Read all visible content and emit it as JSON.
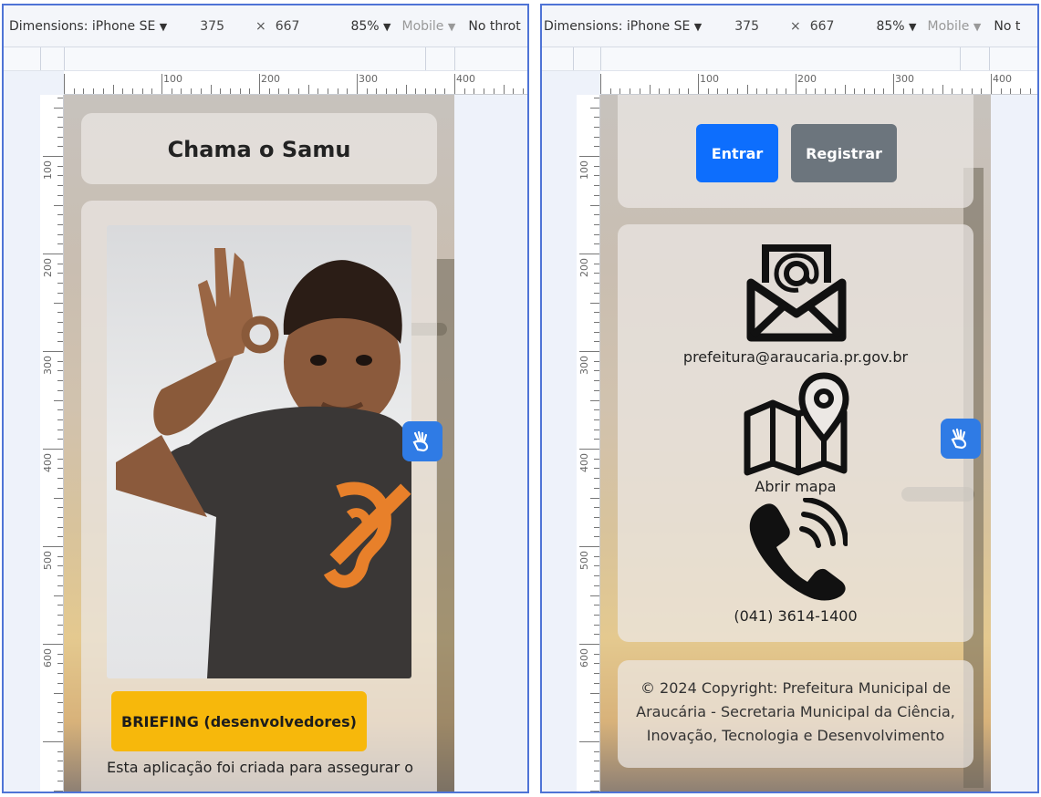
{
  "devtools": {
    "dimensions_label": "Dimensions: iPhone SE",
    "width": "375",
    "times": "×",
    "height": "667",
    "zoom": "85%",
    "mobile": "Mobile",
    "throttle_left": "No throt",
    "throttle_right": "No t",
    "caret": "▼"
  },
  "ruler": {
    "h_labels": [
      "100",
      "200",
      "300",
      "400"
    ],
    "v_labels": [
      "100",
      "200",
      "300",
      "400",
      "500",
      "600"
    ]
  },
  "left_page": {
    "title": "Chama o Samu",
    "briefing_button": "BRIEFING (desenvolvedores)",
    "description": "Esta aplicação foi criada para assegurar o"
  },
  "right_page": {
    "login_button": "Entrar",
    "register_button": "Registrar",
    "email": "prefeitura@araucaria.pr.gov.br",
    "map_link": "Abrir mapa",
    "phone": "(041) 3614-1400",
    "copyright": "© 2024 Copyright: Prefeitura Municipal de Araucária - Secretaria Municipal da Ciência, Inovação, Tecnologia e Desenvolvimento"
  },
  "colors": {
    "frame_border": "#4f74d6",
    "primary": "#0d6efd",
    "secondary": "#6c757d",
    "warning": "#f7b80b",
    "a11y_button": "#2f7be5",
    "ear_logo": "#e8802a"
  },
  "icons": [
    "sign-language-icon",
    "envelope-at-icon",
    "map-pin-icon",
    "phone-icon",
    "hearing-icon",
    "dropdown-caret-icon"
  ]
}
